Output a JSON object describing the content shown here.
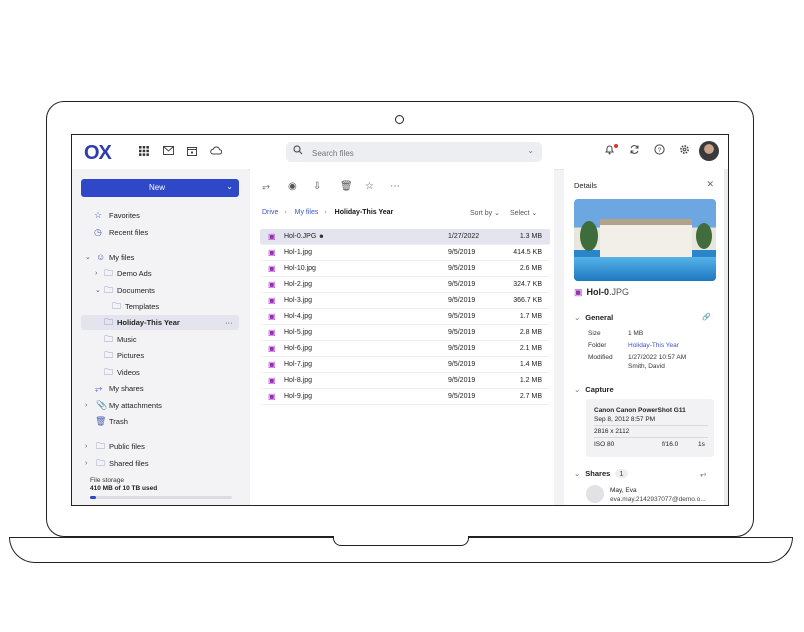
{
  "topbar": {
    "logo": "OX",
    "search_placeholder": "Search files",
    "app_icons": [
      "apps-grid-icon",
      "mail-icon",
      "calendar-icon",
      "cloud-icon"
    ],
    "right_icons": [
      "bell-icon",
      "refresh-icon",
      "help-icon",
      "settings-icon"
    ]
  },
  "sidebar": {
    "new_label": "New",
    "items": [
      {
        "label": "Favorites",
        "icon": "star-icon"
      },
      {
        "label": "Recent files",
        "icon": "clock-icon"
      },
      {
        "label": "My files",
        "icon": "user-icon"
      },
      {
        "label": "Demo Ads",
        "icon": "folder-icon"
      },
      {
        "label": "Documents",
        "icon": "folder-icon"
      },
      {
        "label": "Templates",
        "icon": "folder-icon"
      },
      {
        "label": "Holiday-This Year",
        "icon": "folder-icon"
      },
      {
        "label": "Music",
        "icon": "folder-icon"
      },
      {
        "label": "Pictures",
        "icon": "folder-icon"
      },
      {
        "label": "Videos",
        "icon": "folder-icon"
      },
      {
        "label": "My shares",
        "icon": "share-icon"
      },
      {
        "label": "My attachments",
        "icon": "paperclip-icon"
      },
      {
        "label": "Trash",
        "icon": "trash-icon"
      },
      {
        "label": "Public files",
        "icon": "folder-icon"
      },
      {
        "label": "Shared files",
        "icon": "folder-icon"
      }
    ],
    "more_label": "···",
    "storage_label": "File storage",
    "storage_used": "410 MB of 10 TB used",
    "storage_fraction": 0.04
  },
  "main": {
    "breadcrumb": [
      "Drive",
      "My files",
      "Holiday-This Year"
    ],
    "sort_label": "Sort by",
    "select_label": "Select",
    "files": [
      {
        "name": "Hol-0.JPG",
        "date": "1/27/2022",
        "size": "1.3 MB"
      },
      {
        "name": "Hol-1.jpg",
        "date": "9/5/2019",
        "size": "414.5 KB"
      },
      {
        "name": "Hol-10.jpg",
        "date": "9/5/2019",
        "size": "2.6 MB"
      },
      {
        "name": "Hol-2.jpg",
        "date": "9/5/2019",
        "size": "324.7 KB"
      },
      {
        "name": "Hol-3.jpg",
        "date": "9/5/2019",
        "size": "366.7 KB"
      },
      {
        "name": "Hol-4.jpg",
        "date": "9/5/2019",
        "size": "1.7 MB"
      },
      {
        "name": "Hol-5.jpg",
        "date": "9/5/2019",
        "size": "2.8 MB"
      },
      {
        "name": "Hol-6.jpg",
        "date": "9/5/2019",
        "size": "2.1 MB"
      },
      {
        "name": "Hol-7.jpg",
        "date": "9/5/2019",
        "size": "1.4 MB"
      },
      {
        "name": "Hol-8.jpg",
        "date": "9/5/2019",
        "size": "1.2 MB"
      },
      {
        "name": "Hol-9.jpg",
        "date": "9/5/2019",
        "size": "2.7 MB"
      }
    ]
  },
  "details": {
    "title": "Details",
    "file_base": "Hol-0",
    "file_ext": ".JPG",
    "general_label": "General",
    "size_key": "Size",
    "size_val": "1 MB",
    "folder_key": "Folder",
    "folder_val": "Holiday-This Year",
    "modified_key": "Modified",
    "modified_date": "1/27/2022 10:57 AM",
    "modified_by": "Smith, David",
    "capture_label": "Capture",
    "camera": "Canon Canon PowerShot G11",
    "capture_date": "Sep 8, 2012 8:57 PM",
    "resolution": "2816 x 2112",
    "iso": "ISO 80",
    "aperture": "f/16.0",
    "exposure": "1s",
    "shares_label": "Shares",
    "shares_count": "1",
    "share_name": "May, Eva",
    "share_email": "eva.may.2142937077@demo.o..."
  }
}
